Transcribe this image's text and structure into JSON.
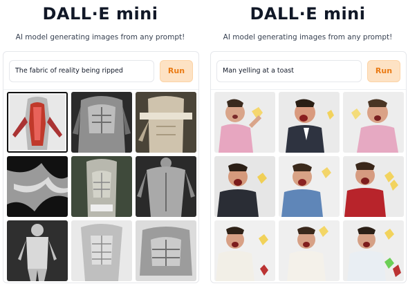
{
  "panels": [
    {
      "title": "DALL·E mini",
      "subtitle": "AI model generating images from any prompt!",
      "prompt_value": "The fabric of reality being ripped",
      "run_label": "Run",
      "images": [
        "torso-red-ripped",
        "torso-gray",
        "torso-pale",
        "fabric-folds",
        "torso-greenish",
        "torso-back",
        "figure-standing",
        "torso-front",
        "torso-seated"
      ]
    },
    {
      "title": "DALL·E mini",
      "subtitle": "AI model generating images from any prompt!",
      "prompt_value": "Man yelling at a toast",
      "run_label": "Run",
      "images": [
        "man-pink-shirt",
        "man-dark-jacket",
        "man-pink-shirt-2",
        "man-dark-suit",
        "man-blue-shirt",
        "man-red-shirt",
        "man-white-shirt",
        "man-white-shirt-2",
        "man-green-drink"
      ]
    }
  ],
  "colors": {
    "accent": "#ea7a13",
    "run_bg": "#fde2c4"
  }
}
